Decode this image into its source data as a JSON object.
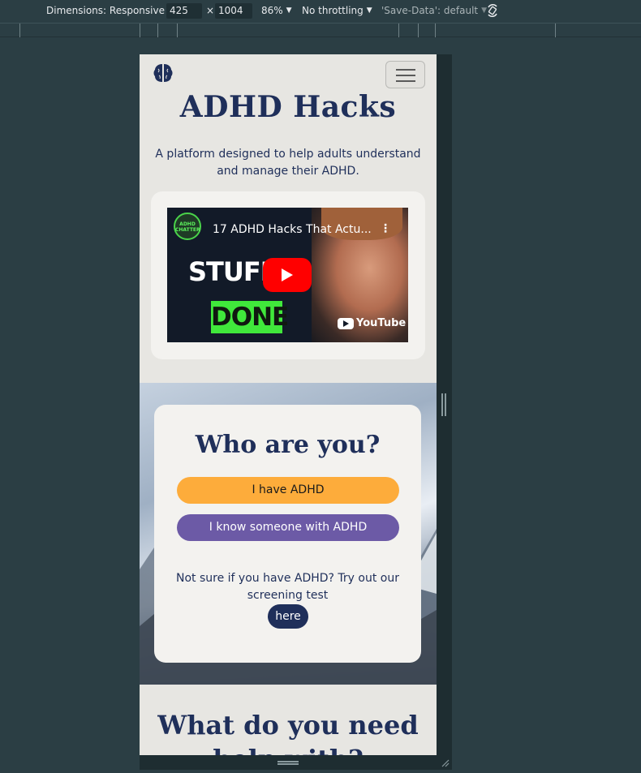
{
  "devtools": {
    "dimensions_label": "Dimensions: Responsive",
    "width_value": "425",
    "times": "×",
    "height_value": "1004",
    "zoom": "86%",
    "throttling": "No throttling",
    "save_data": "'Save-Data': default"
  },
  "site": {
    "title": "ADHD Hacks",
    "subtitle": "A platform designed to help adults understand and manage their ADHD.",
    "video": {
      "channel_badge": "ADHD CHATTER",
      "title": "17 ADHD Hacks That Actu...",
      "thumb_word_1": "STUFF",
      "thumb_word_2": "DONE",
      "brand": "YouTube"
    },
    "who": {
      "heading": "Who are you?",
      "btn_have": "I have ADHD",
      "btn_know": "I know someone with ADHD",
      "not_sure": "Not sure if you have ADHD? Try out our screening test",
      "btn_here": "here"
    },
    "next_heading": "What do you need help with?"
  },
  "colors": {
    "navy": "#1f2f5a",
    "orange": "#fdac3b",
    "purple": "#6c5aa6",
    "page_bg": "#e7e6e2",
    "card_bg": "#f3f2ef",
    "devtools_bg": "#2b3e44"
  },
  "icons": [
    "brain-icon",
    "hamburger-icon",
    "rotate-icon",
    "play-icon",
    "youtube-icon"
  ]
}
